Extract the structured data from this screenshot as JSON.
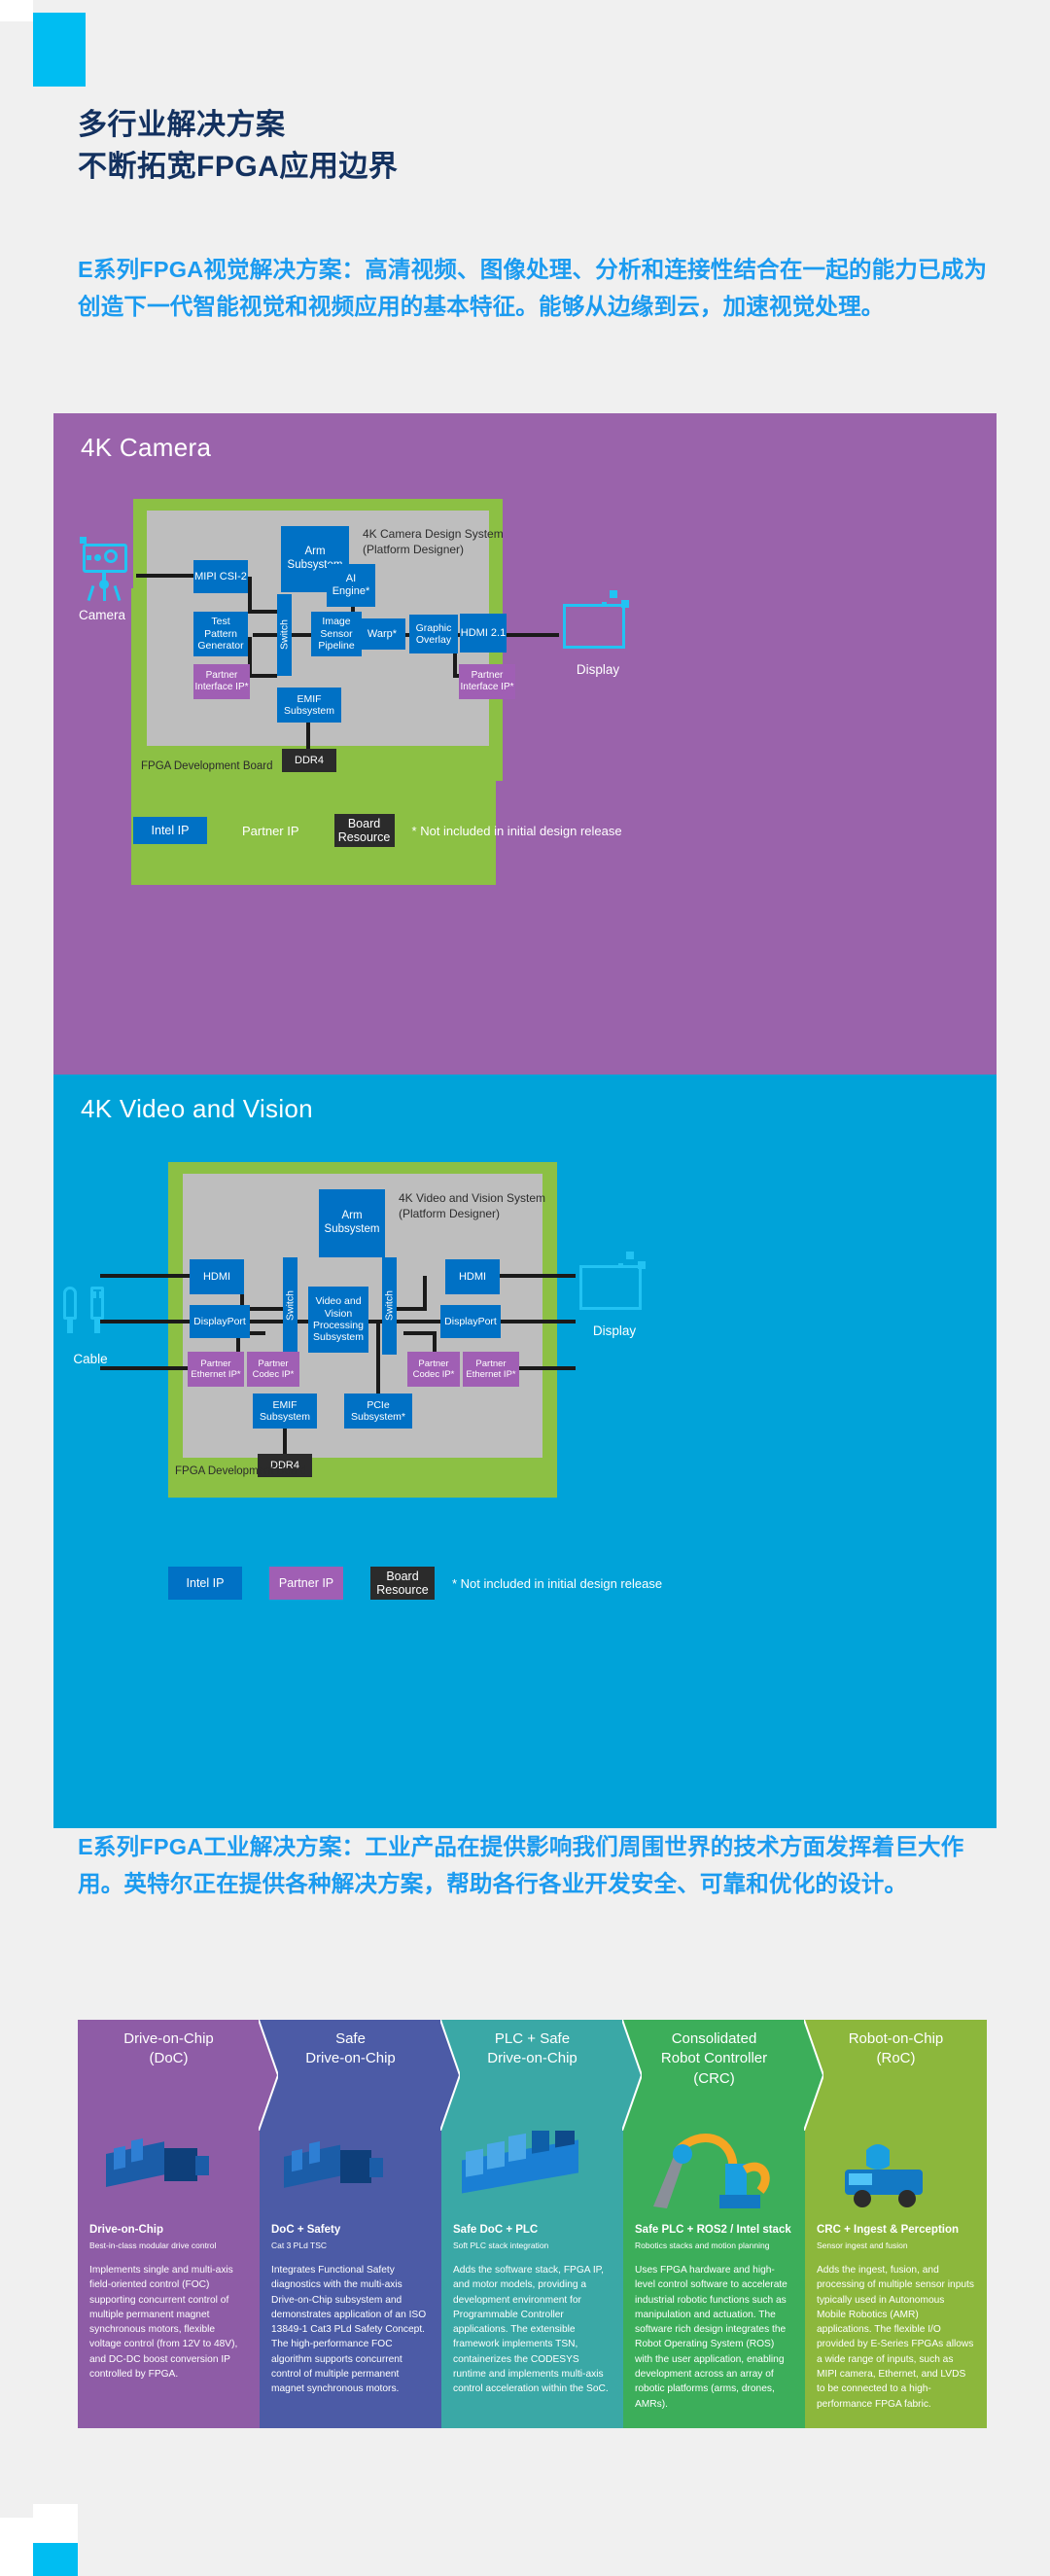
{
  "headline": {
    "line1": "多行业解决方案",
    "line2": "不断拓宽FPGA应用边界"
  },
  "intro_vision": "E系列FPGA视觉解决方案：高清视频、图像处理、分析和连接性结合在一起的能力已成为创造下一代智能视觉和视频应用的基本特征。能够从边缘到云，加速视觉处理。",
  "intro_industrial": "E系列FPGA工业解决方案：工业产品在提供影响我们周围世界的技术方面发挥着巨大作用。英特尔正在提供各种解决方案，帮助各行各业开发安全、可靠和优化的设计。",
  "colors": {
    "navy": "#13315f",
    "cyan": "#00bdf2",
    "blue_text": "#1b9bf0",
    "intel_blue": "#0071c5",
    "partner_purple": "#a05fb4",
    "board_black": "#2b2b2b",
    "panel_purple": "#9a63ab",
    "panel_cyan": "#00a3d9",
    "board_green": "#8cc044",
    "system_grey": "#bebebe"
  },
  "diagram_camera": {
    "title": "4K Camera",
    "system_name_line1": "4K Camera Design System",
    "system_name_line2": "(Platform Designer)",
    "board_label": "FPGA Development Board",
    "external": {
      "left": "Camera",
      "right": "Display"
    },
    "blocks": {
      "arm": "Arm\nSubsystem",
      "mipi": "MIPI CSI-2",
      "ai": "AI\nEngine*",
      "test_pattern": "Test\nPattern\nGenerator",
      "switch": "Switch",
      "image_sensor": "Image\nSensor\nPipeline",
      "warp": "Warp*",
      "graphic_overlay": "Graphic\nOverlay",
      "hdmi21": "HDMI 2.1",
      "partner_left": "Partner\nInterface IP*",
      "partner_right": "Partner\nInterface IP*",
      "emif": "EMIF\nSubsystem",
      "ddr4": "DDR4"
    },
    "legend": {
      "intel": "Intel IP",
      "partner": "Partner IP",
      "board": "Board\nResource",
      "note": "* Not included in initial design release"
    }
  },
  "diagram_video": {
    "title": "4K Video and Vision",
    "system_name_line1": "4K Video and Vision System",
    "system_name_line2": "(Platform Designer)",
    "board_label": "FPGA Development Board",
    "external": {
      "left": "Cable",
      "right": "Display"
    },
    "blocks": {
      "arm": "Arm\nSubsystem",
      "hdmi_left": "HDMI",
      "hdmi_right": "HDMI",
      "dp_left": "DisplayPort",
      "dp_right": "DisplayPort",
      "switch_left": "Switch",
      "switch_right": "Switch",
      "vvps": "Video and\nVision\nProcessing\nSubsystem",
      "partner_eth_left": "Partner\nEthernet IP*",
      "partner_codec_left": "Partner\nCodec IP*",
      "partner_codec_right": "Partner\nCodec IP*",
      "partner_eth_right": "Partner\nEthernet IP*",
      "emif": "EMIF\nSubsystem",
      "pcie": "PCIe\nSubsystem*",
      "ddr4": "DDR4"
    },
    "legend": {
      "intel": "Intel IP",
      "partner": "Partner IP",
      "board": "Board\nResource",
      "note": "* Not included in initial design release"
    }
  },
  "cards": [
    {
      "head": "Drive-on-Chip\n(DoC)",
      "title": "Drive-on-Chip",
      "subtitle": "Best-in-class modular drive control",
      "body": "Implements single and multi-axis field-oriented control (FOC) supporting concurrent control of multiple permanent magnet synchronous motors, flexible voltage control (from 12V to 48V), and DC-DC boost conversion IP controlled by FPGA.",
      "color": "#8e5ca6",
      "icon": "motor-drive-icon"
    },
    {
      "head": "Safe\nDrive-on-Chip",
      "title": "DoC + Safety",
      "subtitle": "Cat 3 PLd  TSC",
      "body": "Integrates Functional Safety diagnostics with the multi-axis Drive-on-Chip subsystem and demonstrates application of an ISO 13849-1 Cat3 PLd Safety Concept. The high-performance FOC algorithm supports concurrent control of multiple permanent magnet synchronous motors.",
      "color": "#4c5ba6",
      "icon": "safe-motor-drive-icon"
    },
    {
      "head": "PLC + Safe\nDrive-on-Chip",
      "title": "Safe DoC + PLC",
      "subtitle": "Soft PLC stack integration",
      "body": "Adds the software stack, FPGA IP, and motor models, providing a development environment for Programmable Controller applications. The extensible framework implements TSN, containerizes the CODESYS runtime and implements multi-axis control acceleration within the SoC.",
      "color": "#3aa8a6",
      "icon": "plc-controller-icon"
    },
    {
      "head": "Consolidated\nRobot Controller\n(CRC)",
      "title": "Safe PLC + ROS2 / Intel stack",
      "subtitle": "Robotics stacks and motion planning",
      "body": "Uses FPGA hardware and high-level control software to accelerate industrial robotic functions such as manipulation and actuation. The software rich design integrates the Robot Operating System (ROS) with the user application, enabling development across an array of robotic platforms (arms, drones, AMRs).",
      "color": "#3cae5a",
      "icon": "robot-arm-icon"
    },
    {
      "head": "Robot-on-Chip\n(RoC)",
      "title": "CRC + Ingest & Perception",
      "subtitle": "Sensor ingest and fusion",
      "body": "Adds the ingest, fusion, and processing of multiple sensor inputs typically used in Autonomous Mobile Robotics (AMR) applications.  The flexible I/O provided by E-Series FPGAs  allows a wide range of inputs, such as MIPI camera, Ethernet, and LVDS to be connected to a high-performance FPGA fabric.",
      "color": "#8cb73c",
      "icon": "mobile-robot-icon"
    }
  ]
}
